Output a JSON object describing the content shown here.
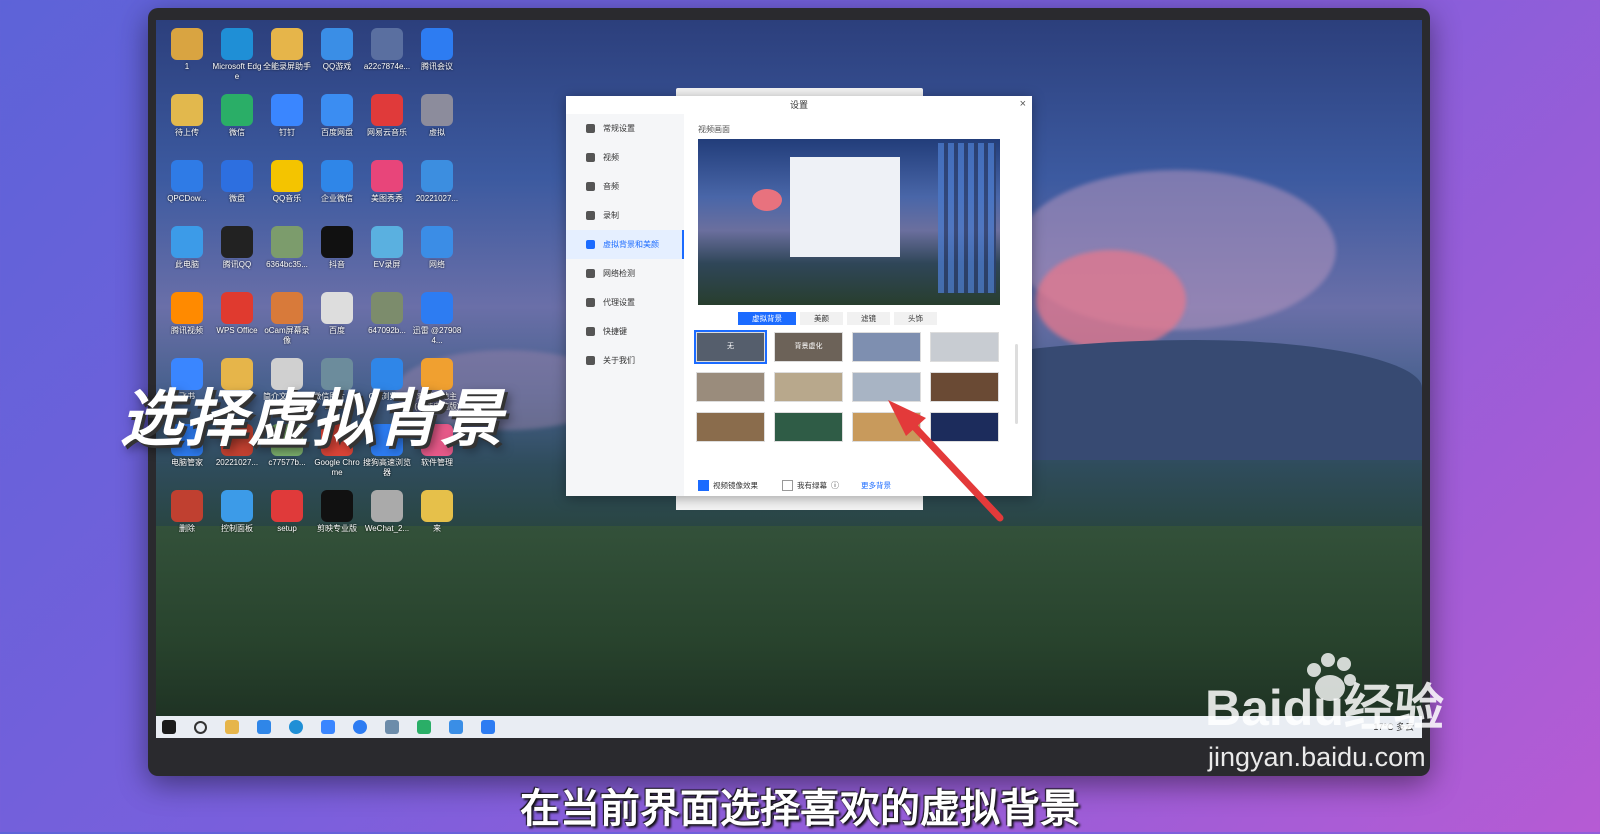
{
  "desktop": {
    "icons": [
      {
        "label": "1",
        "color": "#d9a441"
      },
      {
        "label": "Microsoft Edge",
        "color": "#1f8fd6"
      },
      {
        "label": "全能录屏助手",
        "color": "#e6b54a"
      },
      {
        "label": "QQ游戏",
        "color": "#3a8ee6"
      },
      {
        "label": "a22c7874e...",
        "color": "#5a6fa0"
      },
      {
        "label": "腾讯会议",
        "color": "#2d7cf2"
      },
      {
        "label": "待上传",
        "color": "#e2b84d"
      },
      {
        "label": "微信",
        "color": "#2aae67"
      },
      {
        "label": "钉钉",
        "color": "#3a86ff"
      },
      {
        "label": "百度网盘",
        "color": "#3b8df2"
      },
      {
        "label": "网易云音乐",
        "color": "#e03a3a"
      },
      {
        "label": "虚拟",
        "color": "#8c8c9c"
      },
      {
        "label": "QPCDow...",
        "color": "#2f7be6"
      },
      {
        "label": "微盘",
        "color": "#2d6fe0"
      },
      {
        "label": "QQ音乐",
        "color": "#f4c400"
      },
      {
        "label": "企业微信",
        "color": "#2f86e8"
      },
      {
        "label": "美图秀秀",
        "color": "#e8457a"
      },
      {
        "label": "20221027...",
        "color": "#3c8ee0"
      },
      {
        "label": "此电脑",
        "color": "#3c9be8"
      },
      {
        "label": "腾讯QQ",
        "color": "#222222"
      },
      {
        "label": "6364bc35...",
        "color": "#7c9c6c"
      },
      {
        "label": "抖音",
        "color": "#111111"
      },
      {
        "label": "EV录屏",
        "color": "#5ab0e0"
      },
      {
        "label": "网络",
        "color": "#3b8de6"
      },
      {
        "label": "腾讯视频",
        "color": "#ff8a00"
      },
      {
        "label": "WPS Office",
        "color": "#e03a2f"
      },
      {
        "label": "oCam屏幕录像",
        "color": "#d87a3a"
      },
      {
        "label": "百度",
        "color": "#dddddd"
      },
      {
        "label": "647092b...",
        "color": "#7c8c6c"
      },
      {
        "label": "迅雷 @279084...",
        "color": "#2d7cf2"
      },
      {
        "label": "飞书",
        "color": "#3a86ff"
      },
      {
        "label": "快压",
        "color": "#e6b54a"
      },
      {
        "label": "简介文本模板",
        "color": "#d0d0d0"
      },
      {
        "label": "微信图片 2022050...",
        "color": "#6c8c9c"
      },
      {
        "label": "QQ浏览器",
        "color": "#2f86e8"
      },
      {
        "label": "欢乐斗地主(手游电脑版)",
        "color": "#f0a030"
      },
      {
        "label": "电脑管家",
        "color": "#2d7cf2"
      },
      {
        "label": "20221027...",
        "color": "#c04030"
      },
      {
        "label": "c77577b...",
        "color": "#7caf6c"
      },
      {
        "label": "Google Chrome",
        "color": "#db4437"
      },
      {
        "label": "搜狗高速浏览器",
        "color": "#2d7cf2"
      },
      {
        "label": "软件管理",
        "color": "#e85a8a"
      },
      {
        "label": "删除",
        "color": "#c04030"
      },
      {
        "label": "控制面板",
        "color": "#3c9be8"
      },
      {
        "label": "setup",
        "color": "#e03a3a"
      },
      {
        "label": "剪映专业版",
        "color": "#111111"
      },
      {
        "label": "WeChat_2...",
        "color": "#aaaaaa"
      },
      {
        "label": "来",
        "color": "#e6c04a"
      }
    ]
  },
  "taskbar": {
    "tray_text": "17°C 多云"
  },
  "dialog": {
    "title": "设置",
    "close_glyph": "×",
    "sidebar": [
      {
        "label": "常规设置",
        "active": false
      },
      {
        "label": "视频",
        "active": false
      },
      {
        "label": "音频",
        "active": false
      },
      {
        "label": "录制",
        "active": false
      },
      {
        "label": "虚拟背景和美颜",
        "active": true
      },
      {
        "label": "网络检测",
        "active": false
      },
      {
        "label": "代理设置",
        "active": false
      },
      {
        "label": "快捷键",
        "active": false
      },
      {
        "label": "关于我们",
        "active": false
      }
    ],
    "section_label": "视频画面",
    "tabs": [
      {
        "label": "虚拟背景",
        "active": true
      },
      {
        "label": "美颜",
        "active": false
      },
      {
        "label": "滤镜",
        "active": false
      },
      {
        "label": "头饰",
        "active": false
      }
    ],
    "backgrounds": [
      {
        "label": "无",
        "color": "#555e6c",
        "selected": true
      },
      {
        "label": "背景虚化",
        "color": "#6c6258",
        "selected": false
      },
      {
        "label": "",
        "color": "#7e8fb0",
        "selected": false
      },
      {
        "label": "",
        "color": "#c8ccd2",
        "selected": false
      },
      {
        "label": "",
        "color": "#9a8c7c",
        "selected": false
      },
      {
        "label": "",
        "color": "#b8a88c",
        "selected": false
      },
      {
        "label": "",
        "color": "#a8b4c4",
        "selected": false
      },
      {
        "label": "",
        "color": "#6a4a34",
        "selected": false
      },
      {
        "label": "",
        "color": "#8a6c4c",
        "selected": false
      },
      {
        "label": "",
        "color": "#2f5c46",
        "selected": false
      },
      {
        "label": "",
        "color": "#c89a5c",
        "selected": false
      },
      {
        "label": "",
        "color": "#1c2c5c",
        "selected": false
      }
    ],
    "mirror_label": "视频镜像效果",
    "greenscreen_label": "我有绿幕",
    "more_label": "更多背景"
  },
  "overlay": {
    "big_title": "选择虚拟背景",
    "subtitle": "在当前界面选择喜欢的虚拟背景",
    "watermark_brand": "Baidu经验",
    "watermark_url": "jingyan.baidu.com"
  },
  "colors": {
    "accent": "#1b6bff",
    "arrow": "#e33a3a"
  }
}
